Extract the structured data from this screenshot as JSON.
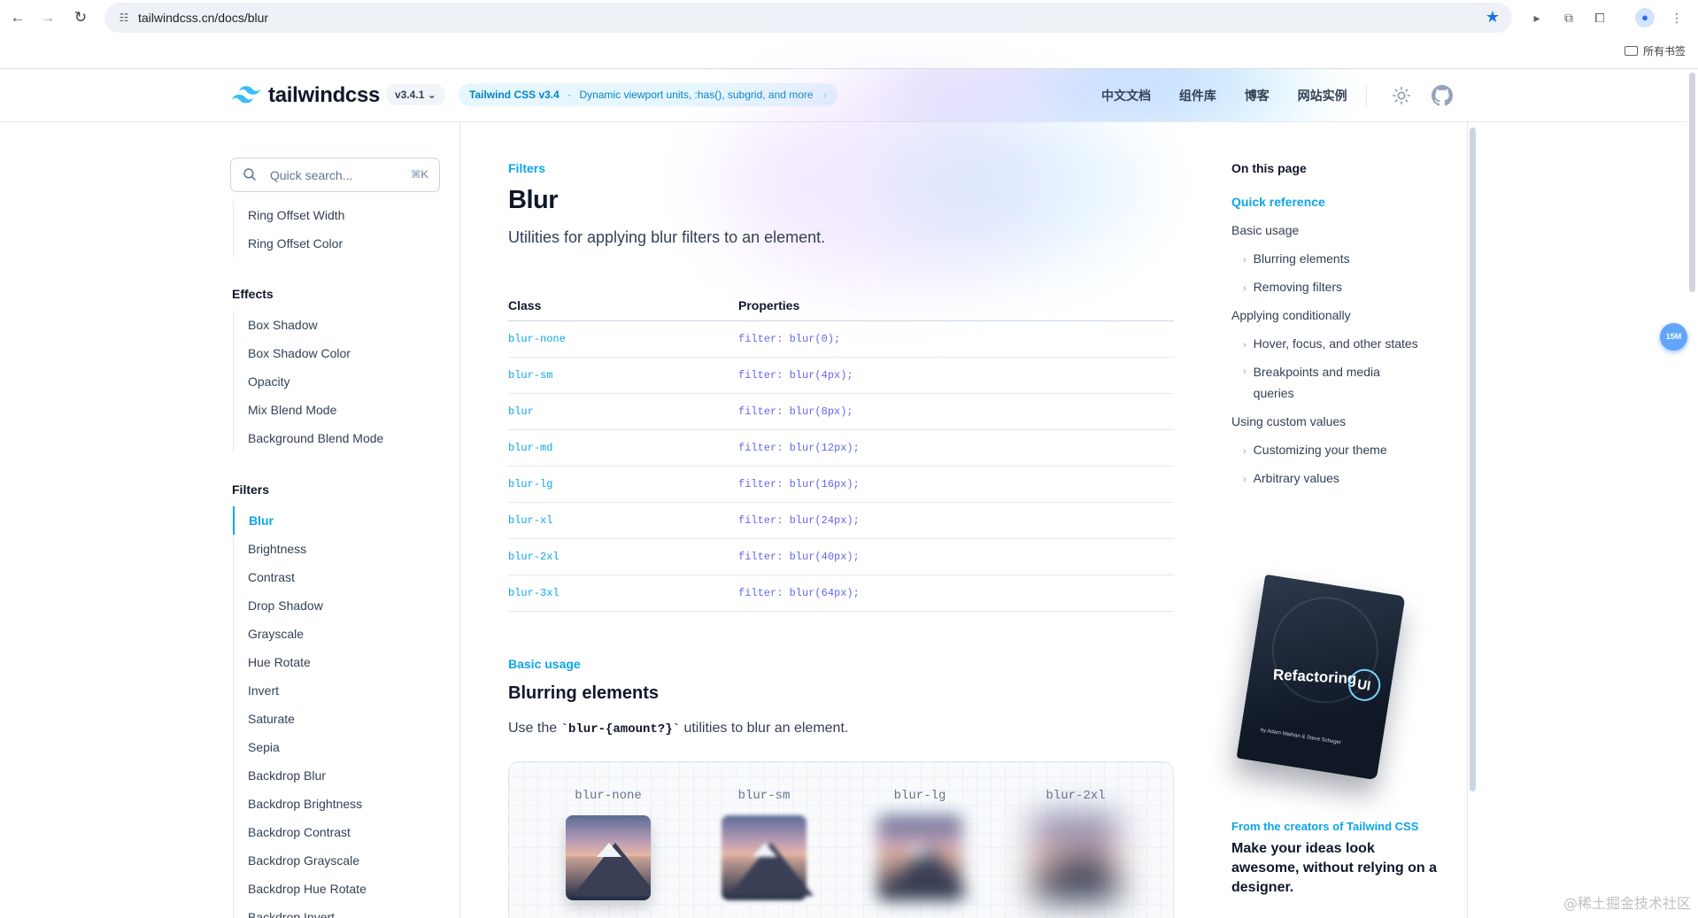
{
  "browser": {
    "url": "tailwindcss.cn/docs/blur",
    "bookmarks_label": "所有书签"
  },
  "header": {
    "logo_text": "tailwindcss",
    "version": "v3.4.1",
    "announce_bold": "Tailwind CSS v3.4",
    "announce_sep": "·",
    "announce_text": "Dynamic viewport units, :has(), subgrid, and more",
    "announce_chevron": "›",
    "nav": [
      "中文文档",
      "组件库",
      "博客",
      "网站实例"
    ]
  },
  "sidebar": {
    "search_placeholder": "Quick search...",
    "search_shortcut": "⌘K",
    "top_items": [
      "Ring Offset Width",
      "Ring Offset Color"
    ],
    "effects_heading": "Effects",
    "effects_items": [
      "Box Shadow",
      "Box Shadow Color",
      "Opacity",
      "Mix Blend Mode",
      "Background Blend Mode"
    ],
    "filters_heading": "Filters",
    "filters_items": [
      "Blur",
      "Brightness",
      "Contrast",
      "Drop Shadow",
      "Grayscale",
      "Hue Rotate",
      "Invert",
      "Saturate",
      "Sepia",
      "Backdrop Blur",
      "Backdrop Brightness",
      "Backdrop Contrast",
      "Backdrop Grayscale",
      "Backdrop Hue Rotate",
      "Backdrop Invert"
    ],
    "active_item": "Blur"
  },
  "main": {
    "eyebrow": "Filters",
    "title": "Blur",
    "lead": "Utilities for applying blur filters to an element.",
    "table": {
      "headers": [
        "Class",
        "Properties"
      ],
      "rows": [
        [
          "blur-none",
          "filter: blur(0);"
        ],
        [
          "blur-sm",
          "filter: blur(4px);"
        ],
        [
          "blur",
          "filter: blur(8px);"
        ],
        [
          "blur-md",
          "filter: blur(12px);"
        ],
        [
          "blur-lg",
          "filter: blur(16px);"
        ],
        [
          "blur-xl",
          "filter: blur(24px);"
        ],
        [
          "blur-2xl",
          "filter: blur(40px);"
        ],
        [
          "blur-3xl",
          "filter: blur(64px);"
        ]
      ]
    },
    "section_eyebrow": "Basic usage",
    "section_title": "Blurring elements",
    "section_desc_before": "Use the ",
    "section_desc_code": "`blur-{amount?}`",
    "section_desc_after": " utilities to blur an element.",
    "demo_labels": [
      "blur-none",
      "blur-sm",
      "blur-lg",
      "blur-2xl"
    ]
  },
  "toc": {
    "heading": "On this page",
    "items": [
      {
        "label": "Quick reference",
        "level": 0,
        "active": true
      },
      {
        "label": "Basic usage",
        "level": 0
      },
      {
        "label": "Blurring elements",
        "level": 1
      },
      {
        "label": "Removing filters",
        "level": 1
      },
      {
        "label": "Applying conditionally",
        "level": 0
      },
      {
        "label": "Hover, focus, and other states",
        "level": 1
      },
      {
        "label": "Breakpoints and media queries",
        "level": 1
      },
      {
        "label": "Using custom values",
        "level": 0
      },
      {
        "label": "Customizing your theme",
        "level": 1
      },
      {
        "label": "Arbitrary values",
        "level": 1
      }
    ]
  },
  "ad": {
    "book_title": "Refactoring",
    "book_title_ring": "UI",
    "book_authors": "by Adam Wathan & Steve Schoger",
    "eyebrow": "From the creators of Tailwind CSS",
    "text": "Make your ideas look awesome, without relying on a designer."
  },
  "badge": "15M",
  "watermark": "@稀土掘金技术社区",
  "colors": {
    "accent": "#0ea5e9",
    "code_prop": "#6366f1",
    "text": "#0f172a"
  }
}
